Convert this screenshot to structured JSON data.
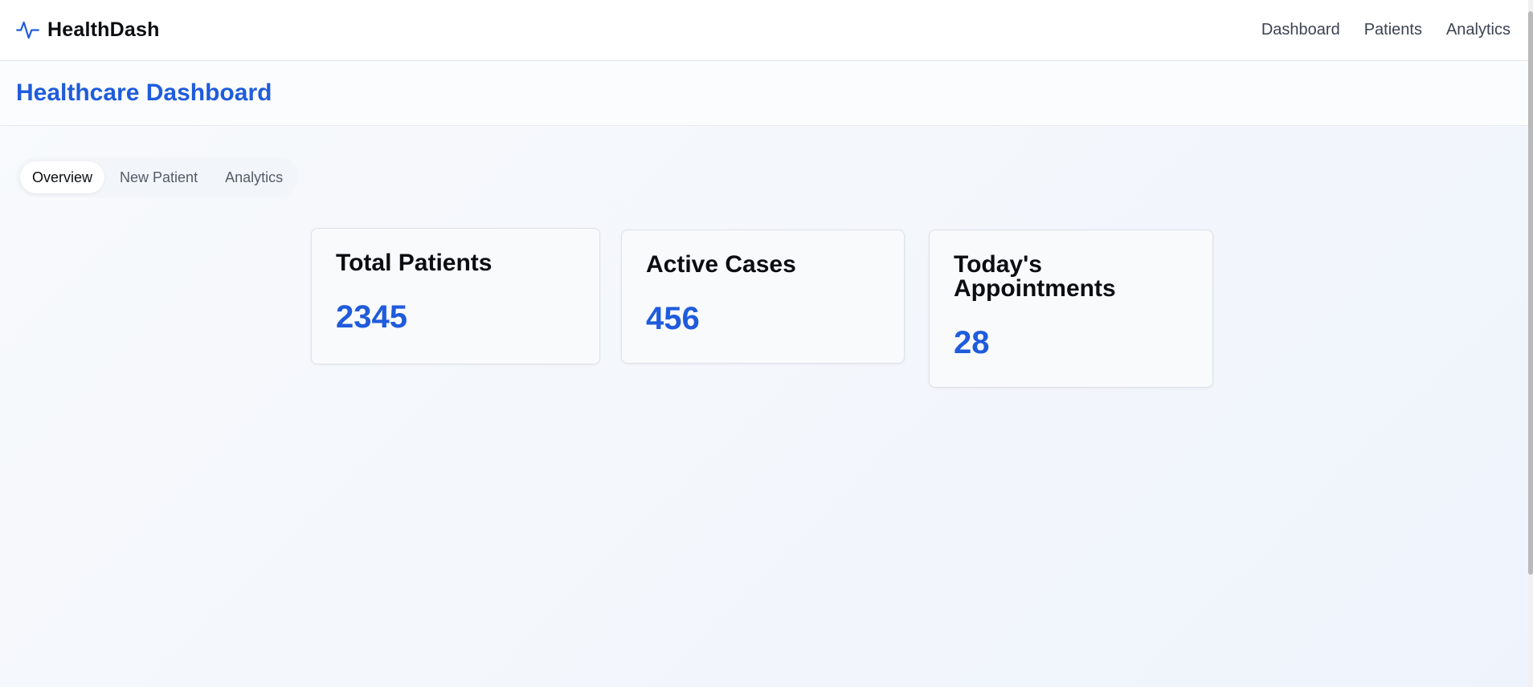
{
  "brand": {
    "name": "HealthDash",
    "icon": "activity-pulse-icon",
    "accent_color": "#1f5bdc"
  },
  "nav": {
    "links": [
      "Dashboard",
      "Patients",
      "Analytics"
    ]
  },
  "header": {
    "title": "Healthcare Dashboard"
  },
  "tabs": {
    "items": [
      "Overview",
      "New Patient",
      "Analytics"
    ],
    "active": "Overview"
  },
  "stats": [
    {
      "label": "Total Patients",
      "value": "2345"
    },
    {
      "label": "Active Cases",
      "value": "456"
    },
    {
      "label": "Today's Appointments",
      "value": "28"
    }
  ]
}
